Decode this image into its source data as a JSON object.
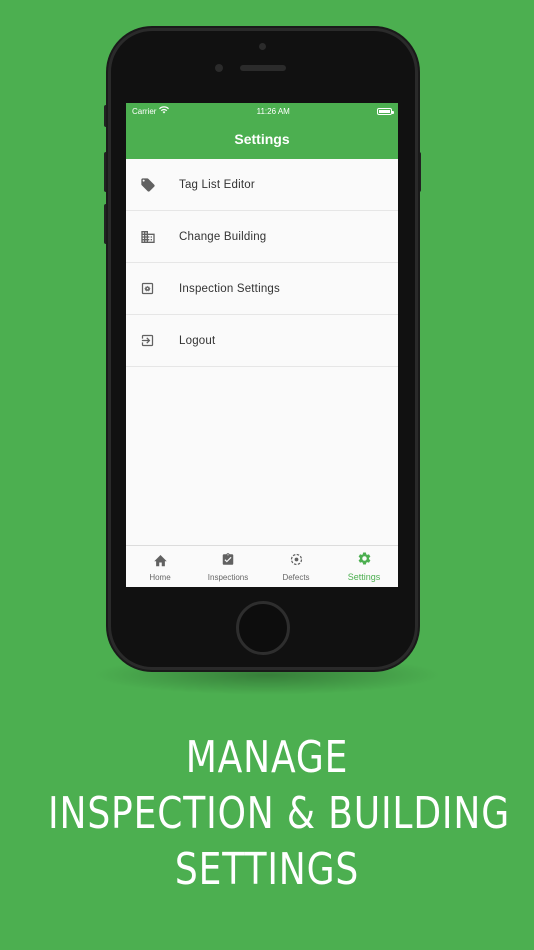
{
  "colors": {
    "background": "#4caf50",
    "accent": "#4caf50",
    "icon": "#616161"
  },
  "status_bar": {
    "carrier": "Carrier",
    "time": "11:26 AM"
  },
  "app_bar": {
    "title": "Settings"
  },
  "menu": {
    "items": [
      {
        "label": "Tag List Editor",
        "icon": "tag-icon"
      },
      {
        "label": "Change Building",
        "icon": "building-icon"
      },
      {
        "label": "Inspection Settings",
        "icon": "settings-box-icon"
      },
      {
        "label": "Logout",
        "icon": "logout-icon"
      }
    ]
  },
  "bottom_nav": {
    "items": [
      {
        "label": "Home",
        "icon": "home-icon",
        "active": false
      },
      {
        "label": "Inspections",
        "icon": "clipboard-check-icon",
        "active": false
      },
      {
        "label": "Defects",
        "icon": "target-icon",
        "active": false
      },
      {
        "label": "Settings",
        "icon": "gear-icon",
        "active": true
      }
    ]
  },
  "tagline": {
    "line1": "MANAGE",
    "line2": "INSPECTION & BUILDING",
    "line3": "SETTINGS"
  }
}
